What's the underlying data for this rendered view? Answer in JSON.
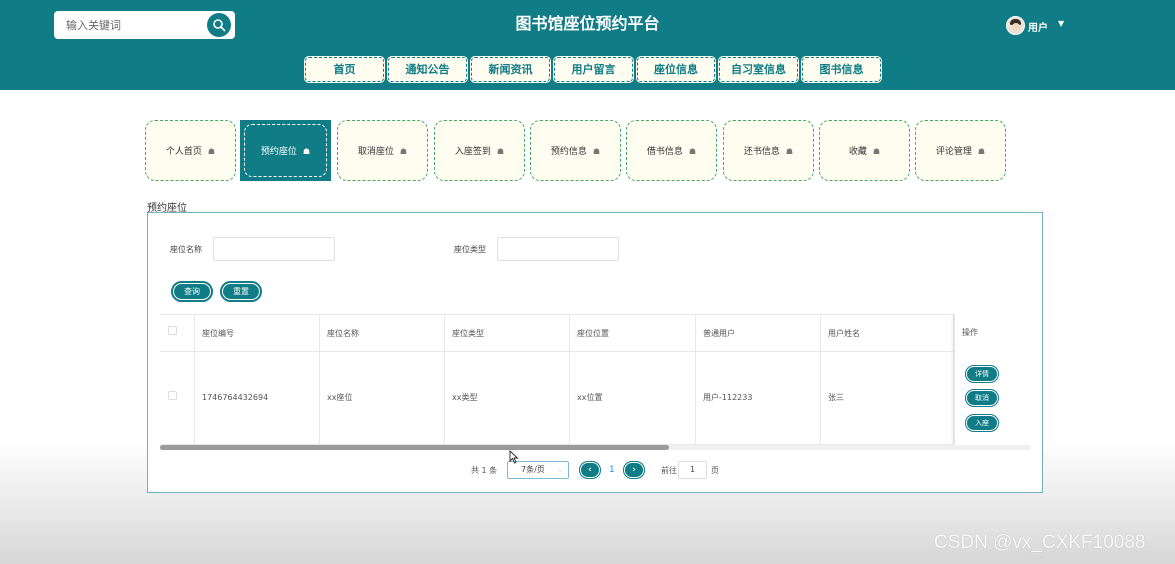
{
  "header": {
    "search_placeholder": "输入关键词",
    "site_title": "图书馆座位预约平台",
    "user_name": "用户"
  },
  "nav": {
    "items": [
      "首页",
      "通知公告",
      "新闻资讯",
      "用户留言",
      "座位信息",
      "自习室信息",
      "图书信息"
    ]
  },
  "subnav": {
    "items": [
      "个人首页",
      "预约座位",
      "取消座位",
      "入座签到",
      "预约信息",
      "借书信息",
      "还书信息",
      "收藏",
      "评论管理"
    ],
    "active_index": 1
  },
  "page": {
    "section_title": "预约座位"
  },
  "filters": {
    "seat_name_label": "座位名称",
    "seat_type_label": "座位类型",
    "search_button": "查询",
    "reset_button": "重置"
  },
  "table": {
    "columns": [
      "座位编号",
      "座位名称",
      "座位类型",
      "座位位置",
      "普通用户",
      "用户姓名"
    ],
    "ops_header": "操作",
    "rows": [
      {
        "cells": [
          "1746764432694",
          "xx座位",
          "xx类型",
          "xx位置",
          "用户-112233",
          "张三"
        ],
        "actions": [
          "详情",
          "取消",
          "入座"
        ]
      }
    ]
  },
  "pagination": {
    "total": "共 1 条",
    "page_size": "7条/页",
    "current_page": "1",
    "goto_prefix": "前往",
    "goto_value": "1",
    "goto_suffix": "页",
    "prev_symbol": "‹",
    "next_symbol": "›"
  },
  "watermark": "CSDN @vx_CXKF10088",
  "colors": {
    "primary": "#0f7c86",
    "tile_bg": "#fffdf0",
    "link_blue": "#2d8cf0"
  }
}
